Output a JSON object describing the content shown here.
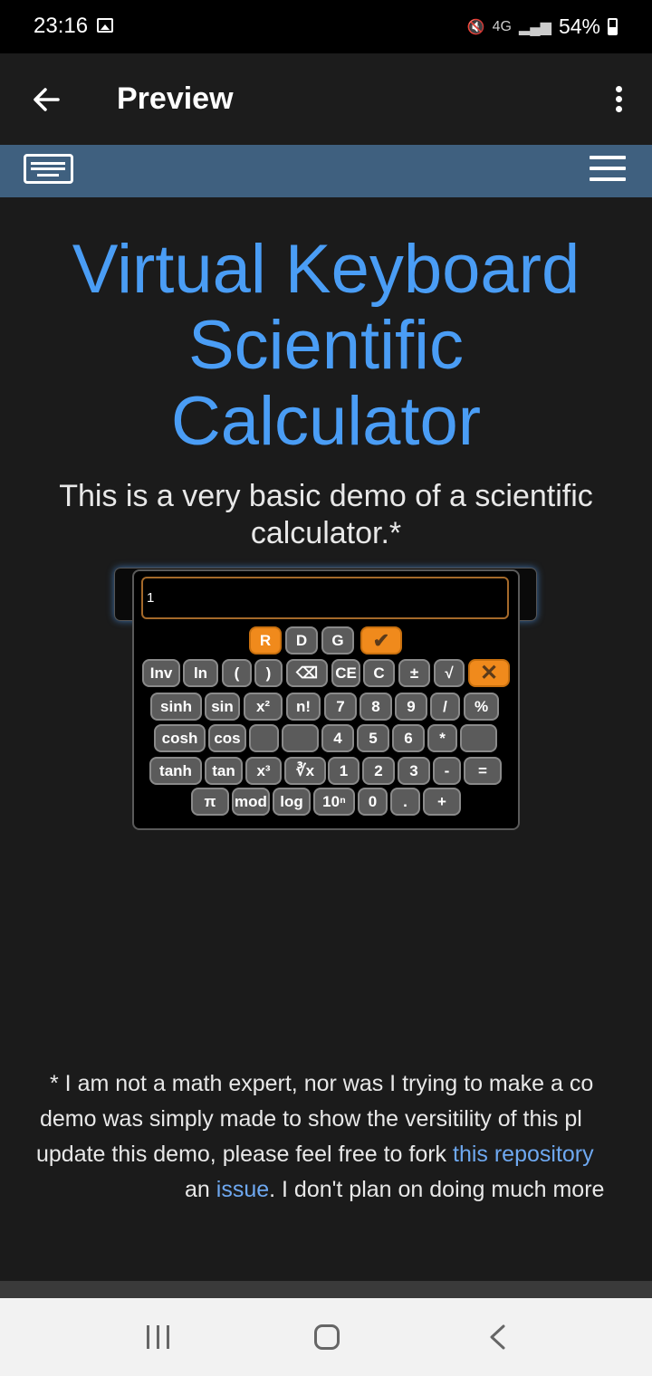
{
  "status_bar": {
    "time": "23:16",
    "network": "4G",
    "battery": "54%"
  },
  "app_bar": {
    "title": "Preview"
  },
  "page": {
    "title_lines": [
      "Virtual Keyboard",
      "Scientific",
      "Calculator"
    ],
    "subtitle_line1": "This is a very basic demo of a scientific",
    "subtitle_line2": "calculator.*"
  },
  "preview": {
    "value": "1"
  },
  "keyboard": {
    "keys": {
      "r": "R",
      "d": "D",
      "g": "G",
      "inv": "Inv",
      "ln": "ln",
      "lparen": "(",
      "rparen": ")",
      "backspace": "⌫",
      "ce": "CE",
      "c": "C",
      "plusminus": "±",
      "sqrt": "√",
      "sinh": "sinh",
      "sin": "sin",
      "x2": "x²",
      "fact": "n!",
      "n7": "7",
      "n8": "8",
      "n9": "9",
      "divide": "/",
      "percent": "%",
      "cosh": "cosh",
      "cos": "cos",
      "n4": "4",
      "n5": "5",
      "n6": "6",
      "multiply": "*",
      "tanh": "tanh",
      "tan": "tan",
      "x3": "x³",
      "cbrt": "∛x",
      "n1": "1",
      "n2": "2",
      "n3": "3",
      "minus": "-",
      "equals": "=",
      "pi": "π",
      "mod": "mod",
      "log": "log",
      "pow10": "10ⁿ",
      "n0": "0",
      "dot": ".",
      "plus": "+"
    }
  },
  "footer": {
    "line1": "* I am not a math expert, nor was I trying to make a co",
    "line2": "demo was simply made to show the versitility of this pl",
    "line3_text": "update this demo, please feel free to fork ",
    "line3_link": "this repository",
    "line4_pre": "an ",
    "line4_link": "issue",
    "line4_post": ". I don't plan on doing much more"
  },
  "colors": {
    "accent": "#4a9df5",
    "header": "#3f607f",
    "key_orange": "#f08a1c"
  }
}
